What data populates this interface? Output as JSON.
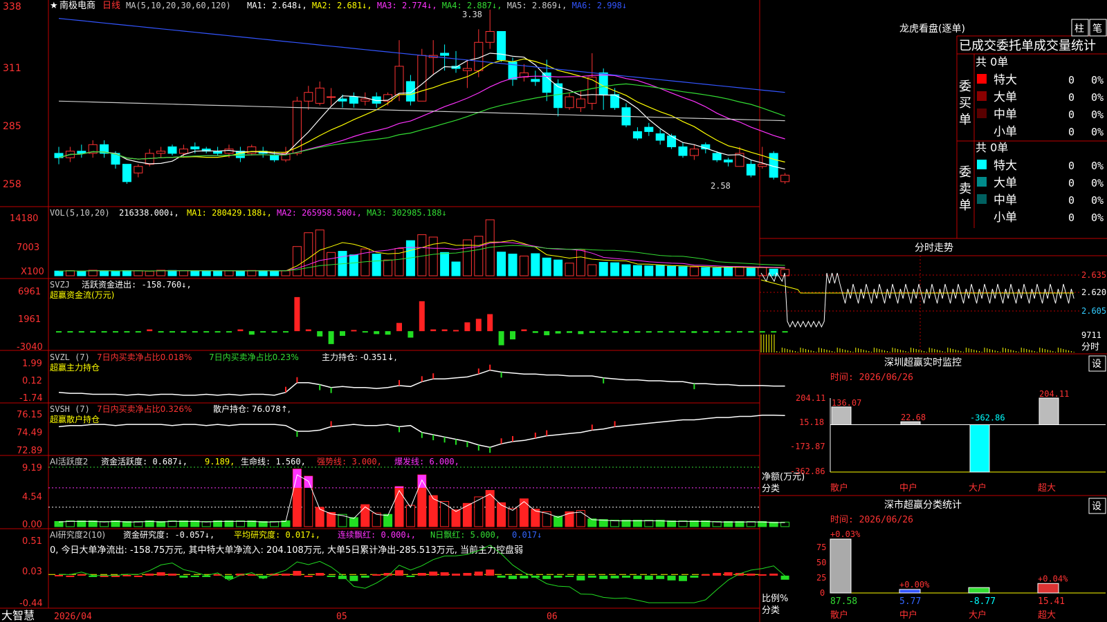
{
  "stock": {
    "name": "南极电商",
    "period": "日线",
    "star": "★"
  },
  "ma_legend": {
    "label": "MA(5,10,20,30,60,120)",
    "items": [
      {
        "text": "MA1: 2.648↓,",
        "color": "#ffffff"
      },
      {
        "text": "MA2: 2.681↓,",
        "color": "#ffff00"
      },
      {
        "text": "MA3: 2.774↓,",
        "color": "#ff33ff"
      },
      {
        "text": "MA4: 2.887↓,",
        "color": "#33dd33"
      },
      {
        "text": "MA5: 2.869↓,",
        "color": "#cccccc"
      },
      {
        "text": "MA6: 2.998↓",
        "color": "#3355ff"
      }
    ]
  },
  "main_axis": {
    "ticks": [
      "338",
      "311",
      "285",
      "258"
    ]
  },
  "annotations": {
    "high": "3.38",
    "low": "2.58"
  },
  "vol_panel": {
    "label": "VOL(5,10,20)",
    "value": "216338.000↓,",
    "items": [
      {
        "text": "MA1: 280429.188↓,",
        "color": "#ffff00"
      },
      {
        "text": "MA2: 265958.500↓,",
        "color": "#ff33ff"
      },
      {
        "text": "MA3: 302985.188↓",
        "color": "#33dd33"
      }
    ],
    "ticks": [
      "14180",
      "7003",
      "X100"
    ]
  },
  "svzj_panel": {
    "label": "SVZJ",
    "line1": "活跃资金进出: -158.760↓,",
    "line2": "超赢资金流(万元)",
    "ticks": [
      "6961",
      "1961",
      "-3040"
    ]
  },
  "svzl_panel": {
    "label": "SVZL (7)",
    "part1": "7日内买卖净占比0.018%",
    "part2": "7日内买卖净占比0.23%",
    "part3": "主力持仓: -0.351↓,",
    "line2": "超赢主力持仓",
    "ticks": [
      "1.99",
      "0.12",
      "-1.74"
    ]
  },
  "svsh_panel": {
    "label": "SVSH (7)",
    "part1": "7日内买卖净占比0.326%",
    "part2": "散户持仓: 76.078↑,",
    "line2": "超赢散户持仓",
    "ticks": [
      "76.15",
      "74.49",
      "72.89"
    ]
  },
  "ai_panel": {
    "label": "AI活跃度2",
    "part1": "资金活跃度: 0.687↓,",
    "part2": "9.189,",
    "part3": "生命线: 1.560,",
    "part4": "强势线: 3.000,",
    "part5": "爆发线: 6.000,",
    "ticks": [
      "9.19",
      "4.54",
      "0.00"
    ]
  },
  "air_panel": {
    "label": "AI研究度2(10)",
    "part1": "资金研究度: -0.057↓,",
    "part2": "平均研究度: 0.017↓,",
    "part3": "连续飘红: 0.000↓,",
    "part4": "N日飘红: 5.000,",
    "part5": "0.017↓",
    "line2": "0, 今日大单净流出: -158.75万元, 其中特大单净流入: 204.108万元, 大单5日累计净出-285.513万元, 当前主力控盘弱",
    "ticks": [
      "0.51",
      "0.03",
      "-0.44"
    ]
  },
  "date_axis": {
    "labels": [
      "2026/04",
      "05",
      "06"
    ]
  },
  "brand": "大智慧",
  "lhb": {
    "title": "龙虎看盘(逐单)",
    "btn1": "柱",
    "btn2": "笔",
    "subtitle": "已成交委托单成交量统计",
    "buy": {
      "side": "委买单",
      "total": "共 0单",
      "rows": [
        {
          "label": "特大",
          "count": "0",
          "pct": "0%",
          "color": "#ff0000"
        },
        {
          "label": "大单",
          "count": "0",
          "pct": "0%",
          "color": "#8b0000"
        },
        {
          "label": "中单",
          "count": "0",
          "pct": "0%",
          "color": "#5a0000"
        },
        {
          "label": "小单",
          "count": "0",
          "pct": "0%",
          "color": "#000000"
        }
      ]
    },
    "sell": {
      "side": "委卖单",
      "total": "共 0单",
      "rows": [
        {
          "label": "特大",
          "count": "0",
          "pct": "0%",
          "color": "#00ffff"
        },
        {
          "label": "大单",
          "count": "0",
          "pct": "0%",
          "color": "#008b8b"
        },
        {
          "label": "中单",
          "count": "0",
          "pct": "0%",
          "color": "#006060"
        },
        {
          "label": "小单",
          "count": "0",
          "pct": "0%",
          "color": "#000000"
        }
      ]
    }
  },
  "intraday": {
    "title": "分时走势",
    "ticks": [
      "2.635",
      "2.620",
      "2.605"
    ],
    "vol_label": "9711",
    "time_label": "分时"
  },
  "sz_monitor": {
    "title": "深圳超赢实时监控",
    "btn": "设",
    "time": "时间: 2026/06/26",
    "ticks": [
      "204.11",
      "15.18",
      "-173.87",
      "-362.86"
    ],
    "ylabel": "净额(万元)",
    "xlabel": "分类",
    "categories": [
      "散户",
      "中户",
      "大户",
      "超大"
    ],
    "values": [
      "136.07",
      "22.68",
      "-362.86",
      "204.11"
    ]
  },
  "sz_class": {
    "title": "深市超赢分类统计",
    "btn": "设",
    "time": "时间: 2026/06/26",
    "ticks": [
      "75",
      "50",
      "25",
      "0"
    ],
    "ylabel": "比例%",
    "xlabel": "分类",
    "categories": [
      "散户",
      "中户",
      "大户",
      "超大"
    ],
    "top_labels": [
      "+0.03%",
      "+0.00%",
      "",
      "+0.04%"
    ],
    "values": [
      "87.58",
      "5.77",
      "-8.77",
      "15.41"
    ]
  },
  "chart_data": [
    {
      "type": "candlestick",
      "title": "南极电商 日线",
      "ylim": [
        2.56,
        3.4
      ],
      "y_ticks": [
        3.38,
        3.11,
        2.85,
        2.58
      ],
      "note": "price data read approx. from chart",
      "candles": [
        [
          2.72,
          2.7,
          2.75,
          2.67
        ],
        [
          2.7,
          2.73,
          2.75,
          2.68
        ],
        [
          2.73,
          2.72,
          2.76,
          2.7
        ],
        [
          2.72,
          2.76,
          2.78,
          2.7
        ],
        [
          2.76,
          2.72,
          2.78,
          2.7
        ],
        [
          2.72,
          2.67,
          2.73,
          2.65
        ],
        [
          2.67,
          2.59,
          2.67,
          2.58
        ],
        [
          2.63,
          2.66,
          2.67,
          2.61
        ],
        [
          2.67,
          2.72,
          2.74,
          2.66
        ],
        [
          2.72,
          2.73,
          2.75,
          2.7
        ],
        [
          2.75,
          2.72,
          2.76,
          2.71
        ],
        [
          2.72,
          2.74,
          2.76,
          2.7
        ],
        [
          2.75,
          2.74,
          2.77,
          2.72
        ],
        [
          2.74,
          2.73,
          2.75,
          2.72
        ],
        [
          2.73,
          2.72,
          2.75,
          2.71
        ],
        [
          2.72,
          2.74,
          2.76,
          2.7
        ],
        [
          2.73,
          2.7,
          2.75,
          2.68
        ],
        [
          2.72,
          2.75,
          2.76,
          2.71
        ],
        [
          2.73,
          2.72,
          2.75,
          2.7
        ],
        [
          2.71,
          2.69,
          2.73,
          2.68
        ],
        [
          2.69,
          2.72,
          2.75,
          2.68
        ],
        [
          2.72,
          2.96,
          2.98,
          2.71
        ],
        [
          2.96,
          3.0,
          3.03,
          2.92
        ],
        [
          2.95,
          3.02,
          3.05,
          2.94
        ],
        [
          2.98,
          2.98,
          3.02,
          2.94
        ],
        [
          2.97,
          2.96,
          2.99,
          2.93
        ],
        [
          2.98,
          2.95,
          3.0,
          2.93
        ],
        [
          2.96,
          2.97,
          3.0,
          2.94
        ],
        [
          2.98,
          2.95,
          3.0,
          2.93
        ],
        [
          2.96,
          2.99,
          3.0,
          2.94
        ],
        [
          2.99,
          3.12,
          3.24,
          2.96
        ],
        [
          3.05,
          2.96,
          3.08,
          2.94
        ],
        [
          2.96,
          3.17,
          3.2,
          2.96
        ],
        [
          3.16,
          3.17,
          3.24,
          3.08
        ],
        [
          3.18,
          3.17,
          3.22,
          3.1
        ],
        [
          3.12,
          3.11,
          3.19,
          3.09
        ],
        [
          3.1,
          3.11,
          3.15,
          3.02
        ],
        [
          3.1,
          3.23,
          3.29,
          3.07
        ],
        [
          3.23,
          3.28,
          3.38,
          3.2
        ],
        [
          3.28,
          3.15,
          3.28,
          3.14
        ],
        [
          3.14,
          3.06,
          3.16,
          3.03
        ],
        [
          3.07,
          3.09,
          3.13,
          3.05
        ],
        [
          3.06,
          3.05,
          3.1,
          3.03
        ],
        [
          3.09,
          3.0,
          3.15,
          2.96
        ],
        [
          3.04,
          2.93,
          3.06,
          2.89
        ],
        [
          2.93,
          2.98,
          3.0,
          2.92
        ],
        [
          2.93,
          2.97,
          3.01,
          2.91
        ],
        [
          2.95,
          3.07,
          3.18,
          2.92
        ],
        [
          3.09,
          2.99,
          3.11,
          2.92
        ],
        [
          2.99,
          2.93,
          3.02,
          2.92
        ],
        [
          2.93,
          2.85,
          2.95,
          2.84
        ],
        [
          2.82,
          2.79,
          2.84,
          2.78
        ],
        [
          2.84,
          2.82,
          2.86,
          2.8
        ],
        [
          2.81,
          2.78,
          2.83,
          2.76
        ],
        [
          2.8,
          2.75,
          2.81,
          2.74
        ],
        [
          2.75,
          2.71,
          2.77,
          2.7
        ],
        [
          2.71,
          2.74,
          2.76,
          2.69
        ],
        [
          2.76,
          2.74,
          2.77,
          2.72
        ],
        [
          2.72,
          2.69,
          2.73,
          2.68
        ],
        [
          2.69,
          2.68,
          2.7,
          2.66
        ],
        [
          2.66,
          2.72,
          2.75,
          2.66
        ],
        [
          2.67,
          2.62,
          2.69,
          2.61
        ],
        [
          2.66,
          2.67,
          2.75,
          2.65
        ],
        [
          2.72,
          2.61,
          2.73,
          2.6
        ],
        [
          2.59,
          2.62,
          2.63,
          2.58
        ]
      ]
    },
    {
      "type": "bar",
      "title": "VOL(5,10,20)",
      "unit": "X100",
      "ylim": [
        0,
        14180
      ],
      "values": [
        1200,
        1300,
        1150,
        1400,
        1250,
        1100,
        1300,
        1250,
        1150,
        1400,
        1350,
        1300,
        1250,
        1200,
        1300,
        1250,
        1150,
        1350,
        1300,
        1200,
        1250,
        7400,
        10900,
        11600,
        5900,
        6200,
        5300,
        6800,
        5500,
        4000,
        6900,
        8900,
        10400,
        9800,
        5900,
        3500,
        9100,
        10000,
        14180,
        6000,
        5500,
        5000,
        5600,
        4500,
        4000,
        3200,
        6500,
        2800,
        3400,
        3300,
        2800,
        2600,
        2500,
        2600,
        2400,
        2300,
        2200,
        2100,
        2000,
        2200,
        2300,
        1900,
        2100,
        1700,
        1600
      ]
    },
    {
      "type": "bar",
      "title": "SVZJ 活跃资金进出",
      "ylim": [
        -3040,
        6961
      ],
      "values": [
        -30,
        -200,
        -180,
        -220,
        -200,
        -190,
        -210,
        -200,
        300,
        -220,
        -200,
        -180,
        -190,
        -200,
        -180,
        -220,
        300,
        -600,
        -200,
        -180,
        -150,
        5800,
        300,
        -900,
        -2200,
        -800,
        200,
        -200,
        -500,
        -600,
        1400,
        -1100,
        5100,
        300,
        300,
        200,
        1500,
        2100,
        2900,
        -2400,
        -1400,
        300,
        -300,
        -700,
        -400,
        -300,
        -500,
        -300,
        -200,
        -200,
        -300,
        -250,
        -250,
        -200,
        -220,
        -200,
        -300,
        -250,
        -220,
        -180,
        -200,
        -150,
        -150,
        -150,
        -158
      ]
    },
    {
      "type": "line",
      "title": "SVZL 主力持仓",
      "ylim": [
        -1.74,
        1.99
      ],
      "values": [
        -1.0,
        -1.1,
        -1.1,
        -1.2,
        -1.2,
        -1.2,
        -1.3,
        -1.2,
        -1.3,
        -1.2,
        -1.2,
        -1.3,
        -1.3,
        -1.2,
        -1.3,
        -1.2,
        -1.3,
        -1.2,
        -1.2,
        -1.3,
        -1.0,
        0.0,
        0.0,
        -0.2,
        -0.5,
        -0.4,
        -0.5,
        -0.5,
        -0.6,
        -0.5,
        -0.3,
        -0.4,
        0.1,
        0.4,
        0.4,
        0.5,
        0.6,
        0.9,
        1.3,
        1.1,
        1.0,
        0.9,
        0.9,
        0.8,
        0.8,
        0.7,
        0.7,
        0.7,
        0.5,
        0.4,
        0.3,
        0.3,
        0.2,
        0.2,
        0.1,
        0.1,
        -0.1,
        -0.1,
        -0.2,
        -0.2,
        -0.3,
        -0.3,
        -0.3,
        -0.35,
        -0.35
      ]
    },
    {
      "type": "line",
      "title": "SVSH 散户持仓",
      "ylim": [
        72.89,
        76.15
      ],
      "values": [
        75.1,
        75.2,
        75.2,
        75.3,
        75.3,
        75.2,
        75.3,
        75.3,
        75.3,
        75.3,
        75.2,
        75.3,
        75.3,
        75.2,
        75.3,
        75.2,
        75.3,
        75.3,
        75.3,
        75.3,
        75.2,
        74.7,
        74.7,
        74.8,
        75.1,
        75.2,
        75.3,
        75.2,
        75.2,
        75.3,
        75.1,
        75.2,
        74.6,
        74.4,
        74.2,
        74.0,
        73.8,
        73.5,
        73.3,
        73.6,
        73.8,
        73.9,
        74.1,
        74.3,
        74.4,
        74.5,
        74.6,
        74.8,
        74.9,
        75.1,
        75.2,
        75.3,
        75.4,
        75.5,
        75.6,
        75.7,
        75.7,
        75.8,
        75.9,
        75.9,
        76.0,
        76.0,
        76.1,
        76.1,
        76.08
      ]
    },
    {
      "type": "bar",
      "title": "AI活跃度2",
      "ylim": [
        0,
        9.19
      ],
      "values": [
        0.8,
        0.9,
        0.9,
        0.9,
        0.8,
        0.9,
        0.8,
        0.8,
        0.9,
        0.8,
        0.9,
        0.9,
        0.9,
        0.8,
        0.9,
        0.9,
        0.9,
        0.9,
        0.8,
        0.8,
        0.9,
        8.9,
        7.8,
        3.0,
        2.2,
        1.9,
        1.4,
        3.4,
        2.1,
        1.9,
        6.2,
        3.3,
        8.0,
        4.8,
        3.9,
        2.6,
        3.6,
        4.6,
        5.6,
        3.7,
        2.8,
        4.3,
        2.7,
        2.3,
        1.6,
        2.3,
        2.5,
        1.2,
        1.1,
        1.0,
        1.0,
        1.0,
        1.0,
        1.0,
        0.9,
        0.9,
        0.9,
        0.9,
        0.8,
        0.8,
        0.8,
        0.8,
        0.8,
        0.7,
        0.7
      ]
    },
    {
      "type": "bar",
      "title": "AI研究度2(10)",
      "ylim": [
        -0.44,
        0.51
      ],
      "values": [
        0.01,
        0.0,
        0.02,
        -0.02,
        0.0,
        0.0,
        0.01,
        0.0,
        0.03,
        0.05,
        0.03,
        -0.03,
        -0.01,
        -0.02,
        0.02,
        -0.05,
        0.03,
        0.02,
        -0.04,
        0.03,
        0.03,
        0.07,
        0.0,
        0.04,
        -0.02,
        -0.05,
        -0.08,
        -0.03,
        0.02,
        0.04,
        0.08,
        -0.02,
        0.04,
        0.06,
        0.05,
        0.03,
        0.04,
        0.06,
        0.09,
        -0.03,
        -0.05,
        -0.04,
        -0.03,
        -0.05,
        -0.03,
        -0.02,
        -0.07,
        -0.03,
        -0.05,
        -0.04,
        -0.03,
        -0.05,
        -0.06,
        -0.05,
        -0.07,
        -0.08,
        -0.03,
        0.02,
        0.04,
        0.05,
        0.04,
        0.03,
        0.02,
        0.03,
        -0.06
      ]
    },
    {
      "type": "bar",
      "title": "深圳超赢实时监控",
      "categories": [
        "散户",
        "中户",
        "大户",
        "超大"
      ],
      "values": [
        136.07,
        22.68,
        -362.86,
        204.11
      ],
      "ylabel": "净额(万元)"
    },
    {
      "type": "bar",
      "title": "深市超赢分类统计",
      "categories": [
        "散户",
        "中户",
        "大户",
        "超大"
      ],
      "values": [
        87.58,
        5.77,
        -8.77,
        15.41
      ],
      "ylabel": "比例%"
    }
  ]
}
